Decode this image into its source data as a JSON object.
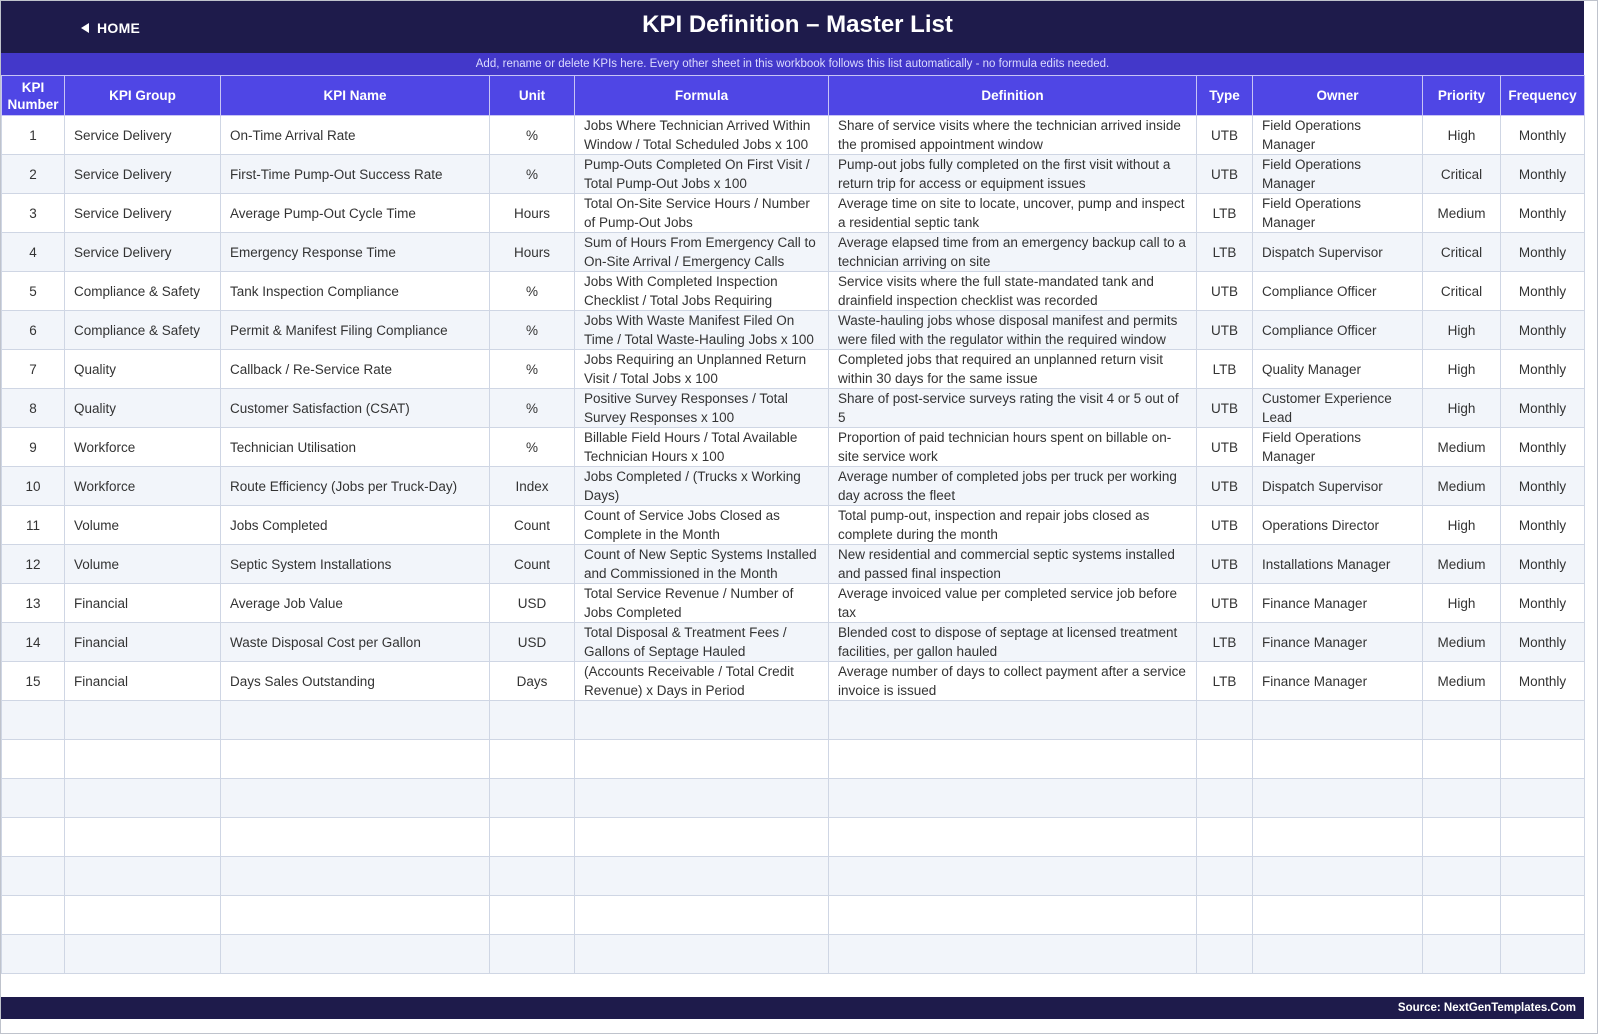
{
  "header": {
    "home_label": "HOME",
    "title": "KPI Definition  –  Master List",
    "subtitle": "Add, rename or delete KPIs here. Every other sheet in this workbook follows this list automatically - no formula edits needed."
  },
  "colors": {
    "header_bg": "#1e1b4b",
    "subbar_bg": "#4338ca",
    "table_header_bg": "#4f46e5",
    "alt_row_bg": "#f2f5fa"
  },
  "table": {
    "columns": [
      "KPI Number",
      "KPI Group",
      "KPI Name",
      "Unit",
      "Formula",
      "Definition",
      "Type",
      "Owner",
      "Priority",
      "Frequency"
    ],
    "rows": [
      [
        "1",
        "Service Delivery",
        "On-Time Arrival Rate",
        "%",
        "Jobs Where Technician Arrived Within Window / Total Scheduled Jobs x 100",
        "Share of service visits where the technician arrived inside the promised appointment window",
        "UTB",
        "Field Operations Manager",
        "High",
        "Monthly"
      ],
      [
        "2",
        "Service Delivery",
        "First-Time Pump-Out Success Rate",
        "%",
        "Pump-Outs Completed On First Visit / Total Pump-Out Jobs x 100",
        "Pump-out jobs fully completed on the first visit without a return trip for access or equipment issues",
        "UTB",
        "Field Operations Manager",
        "Critical",
        "Monthly"
      ],
      [
        "3",
        "Service Delivery",
        "Average Pump-Out Cycle Time",
        "Hours",
        "Total On-Site Service Hours / Number of Pump-Out Jobs",
        "Average time on site to locate, uncover, pump and inspect a residential septic tank",
        "LTB",
        "Field Operations Manager",
        "Medium",
        "Monthly"
      ],
      [
        "4",
        "Service Delivery",
        "Emergency Response Time",
        "Hours",
        "Sum of Hours From Emergency Call to On-Site Arrival / Emergency Calls",
        "Average elapsed time from an emergency backup call to a technician arriving on site",
        "LTB",
        "Dispatch Supervisor",
        "Critical",
        "Monthly"
      ],
      [
        "5",
        "Compliance & Safety",
        "Tank Inspection Compliance",
        "%",
        "Jobs With Completed Inspection Checklist / Total Jobs Requiring",
        "Service visits where the full state-mandated tank and drainfield inspection checklist was recorded",
        "UTB",
        "Compliance Officer",
        "Critical",
        "Monthly"
      ],
      [
        "6",
        "Compliance & Safety",
        "Permit & Manifest Filing Compliance",
        "%",
        "Jobs With Waste Manifest Filed On Time / Total Waste-Hauling Jobs x 100",
        "Waste-hauling jobs whose disposal manifest and permits were filed with the regulator within the required window",
        "UTB",
        "Compliance Officer",
        "High",
        "Monthly"
      ],
      [
        "7",
        "Quality",
        "Callback / Re-Service Rate",
        "%",
        "Jobs Requiring an Unplanned Return Visit / Total Jobs x 100",
        "Completed jobs that required an unplanned return visit within 30 days for the same issue",
        "LTB",
        "Quality Manager",
        "High",
        "Monthly"
      ],
      [
        "8",
        "Quality",
        "Customer Satisfaction (CSAT)",
        "%",
        "Positive Survey Responses / Total Survey Responses x 100",
        "Share of post-service surveys rating the visit 4 or 5 out of 5",
        "UTB",
        "Customer Experience Lead",
        "High",
        "Monthly"
      ],
      [
        "9",
        "Workforce",
        "Technician Utilisation",
        "%",
        "Billable Field Hours / Total Available Technician Hours x 100",
        "Proportion of paid technician hours spent on billable on-site service work",
        "UTB",
        "Field Operations Manager",
        "Medium",
        "Monthly"
      ],
      [
        "10",
        "Workforce",
        "Route Efficiency (Jobs per Truck-Day)",
        "Index",
        "Jobs Completed / (Trucks x Working Days)",
        "Average number of completed jobs per truck per working day across the fleet",
        "UTB",
        "Dispatch Supervisor",
        "Medium",
        "Monthly"
      ],
      [
        "11",
        "Volume",
        "Jobs Completed",
        "Count",
        "Count of Service Jobs Closed as Complete in the Month",
        "Total pump-out, inspection and repair jobs closed as complete during the month",
        "UTB",
        "Operations Director",
        "High",
        "Monthly"
      ],
      [
        "12",
        "Volume",
        "Septic System Installations",
        "Count",
        "Count of New Septic Systems Installed and Commissioned in the Month",
        "New residential and commercial septic systems installed and passed final inspection",
        "UTB",
        "Installations Manager",
        "Medium",
        "Monthly"
      ],
      [
        "13",
        "Financial",
        "Average Job Value",
        "USD",
        "Total Service Revenue / Number of Jobs Completed",
        "Average invoiced value per completed service job before tax",
        "UTB",
        "Finance Manager",
        "High",
        "Monthly"
      ],
      [
        "14",
        "Financial",
        "Waste Disposal Cost per Gallon",
        "USD",
        "Total Disposal & Treatment Fees / Gallons of Septage Hauled",
        "Blended cost to dispose of septage at licensed treatment facilities, per gallon hauled",
        "LTB",
        "Finance Manager",
        "Medium",
        "Monthly"
      ],
      [
        "15",
        "Financial",
        "Days Sales Outstanding",
        "Days",
        "(Accounts Receivable / Total Credit Revenue) x Days in Period",
        "Average number of days to collect payment after a service invoice is issued",
        "LTB",
        "Finance Manager",
        "Medium",
        "Monthly"
      ]
    ]
  },
  "footer": {
    "source": "Source: NextGenTemplates.Com"
  }
}
